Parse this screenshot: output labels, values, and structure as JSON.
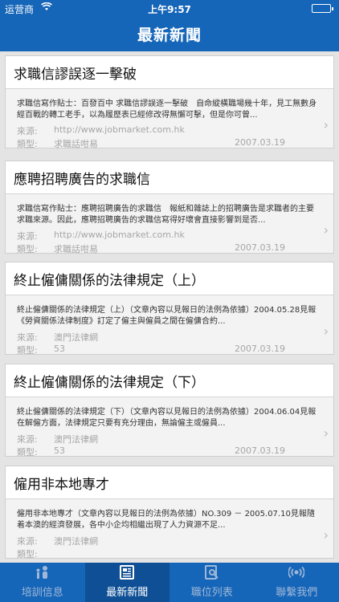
{
  "status_bar": {
    "carrier": "运营商",
    "wifi": "WiFi",
    "time": "上午9:57"
  },
  "nav": {
    "title": "最新新聞"
  },
  "articles": [
    {
      "title": "求職信謬誤逐一擊破",
      "summary": "求職信寫作貼士：百發百中 求職信謬誤逐一擊破　自命縱橫職場幾十年，見工無數身經百戰的轉工老手，以為履歷表已經修改得無懈可擊，但是你可曾...",
      "source_label": "來源:",
      "source": "http://www.jobmarket.com.hk",
      "type_label": "類型:",
      "type": "求職話咁易",
      "date": "2007.03.19"
    },
    {
      "title": "應聘招聘廣告的求職信",
      "summary": "求職信寫作貼士：應聘招聘廣告的求職信　報紙和雜誌上的招聘廣告是求職者的主要求職來源。因此，應聘招聘廣告的求職信寫得好壞會直接影響到是否...",
      "source_label": "來源:",
      "source": "http://www.jobmarket.com.hk",
      "type_label": "類型:",
      "type": "求職話咁易",
      "date": "2007.03.19"
    },
    {
      "title": "終止僱傭關係的法律規定（上）",
      "summary": "終止僱傭關係的法律規定（上）（文章內容以見報日的法例為依據）2004.05.28見報《勞資關係法律制度》訂定了僱主與僱員之間在僱傭合約...",
      "source_label": "來源:",
      "source": "澳門法律網",
      "type_label": "類型:",
      "type": "53",
      "date": "2007.03.19"
    },
    {
      "title": "終止僱傭關係的法律規定（下）",
      "summary": "終止僱傭關係的法律規定（下）（文章內容以見報日的法例為依據）2004.06.04見報在解僱方面，法律規定只要有充分理由，無論僱主或僱員...",
      "source_label": "來源:",
      "source": "澳門法律網",
      "type_label": "類型:",
      "type": "53",
      "date": "2007.03.19"
    },
    {
      "title": "僱用非本地專才",
      "summary": "僱用非本地專才（文章內容以見報日的法例為依據）NO.309 － 2005.07.10見報隨着本澳的經濟發展，各中小企均相繼出現了人力資源不足...",
      "source_label": "來源:",
      "source": "澳門法律網",
      "type_label": "類型:",
      "type": "",
      "date": ""
    }
  ],
  "tabs": [
    {
      "label": "培訓信息",
      "icon": "people-icon",
      "active": false
    },
    {
      "label": "最新新聞",
      "icon": "news-icon",
      "active": true
    },
    {
      "label": "職位列表",
      "icon": "search-list-icon",
      "active": false
    },
    {
      "label": "聯繫我們",
      "icon": "broadcast-icon",
      "active": false
    }
  ],
  "colors": {
    "primary": "#1565b8",
    "tab_active": "#0e4f95",
    "background": "#e4e4e4"
  }
}
